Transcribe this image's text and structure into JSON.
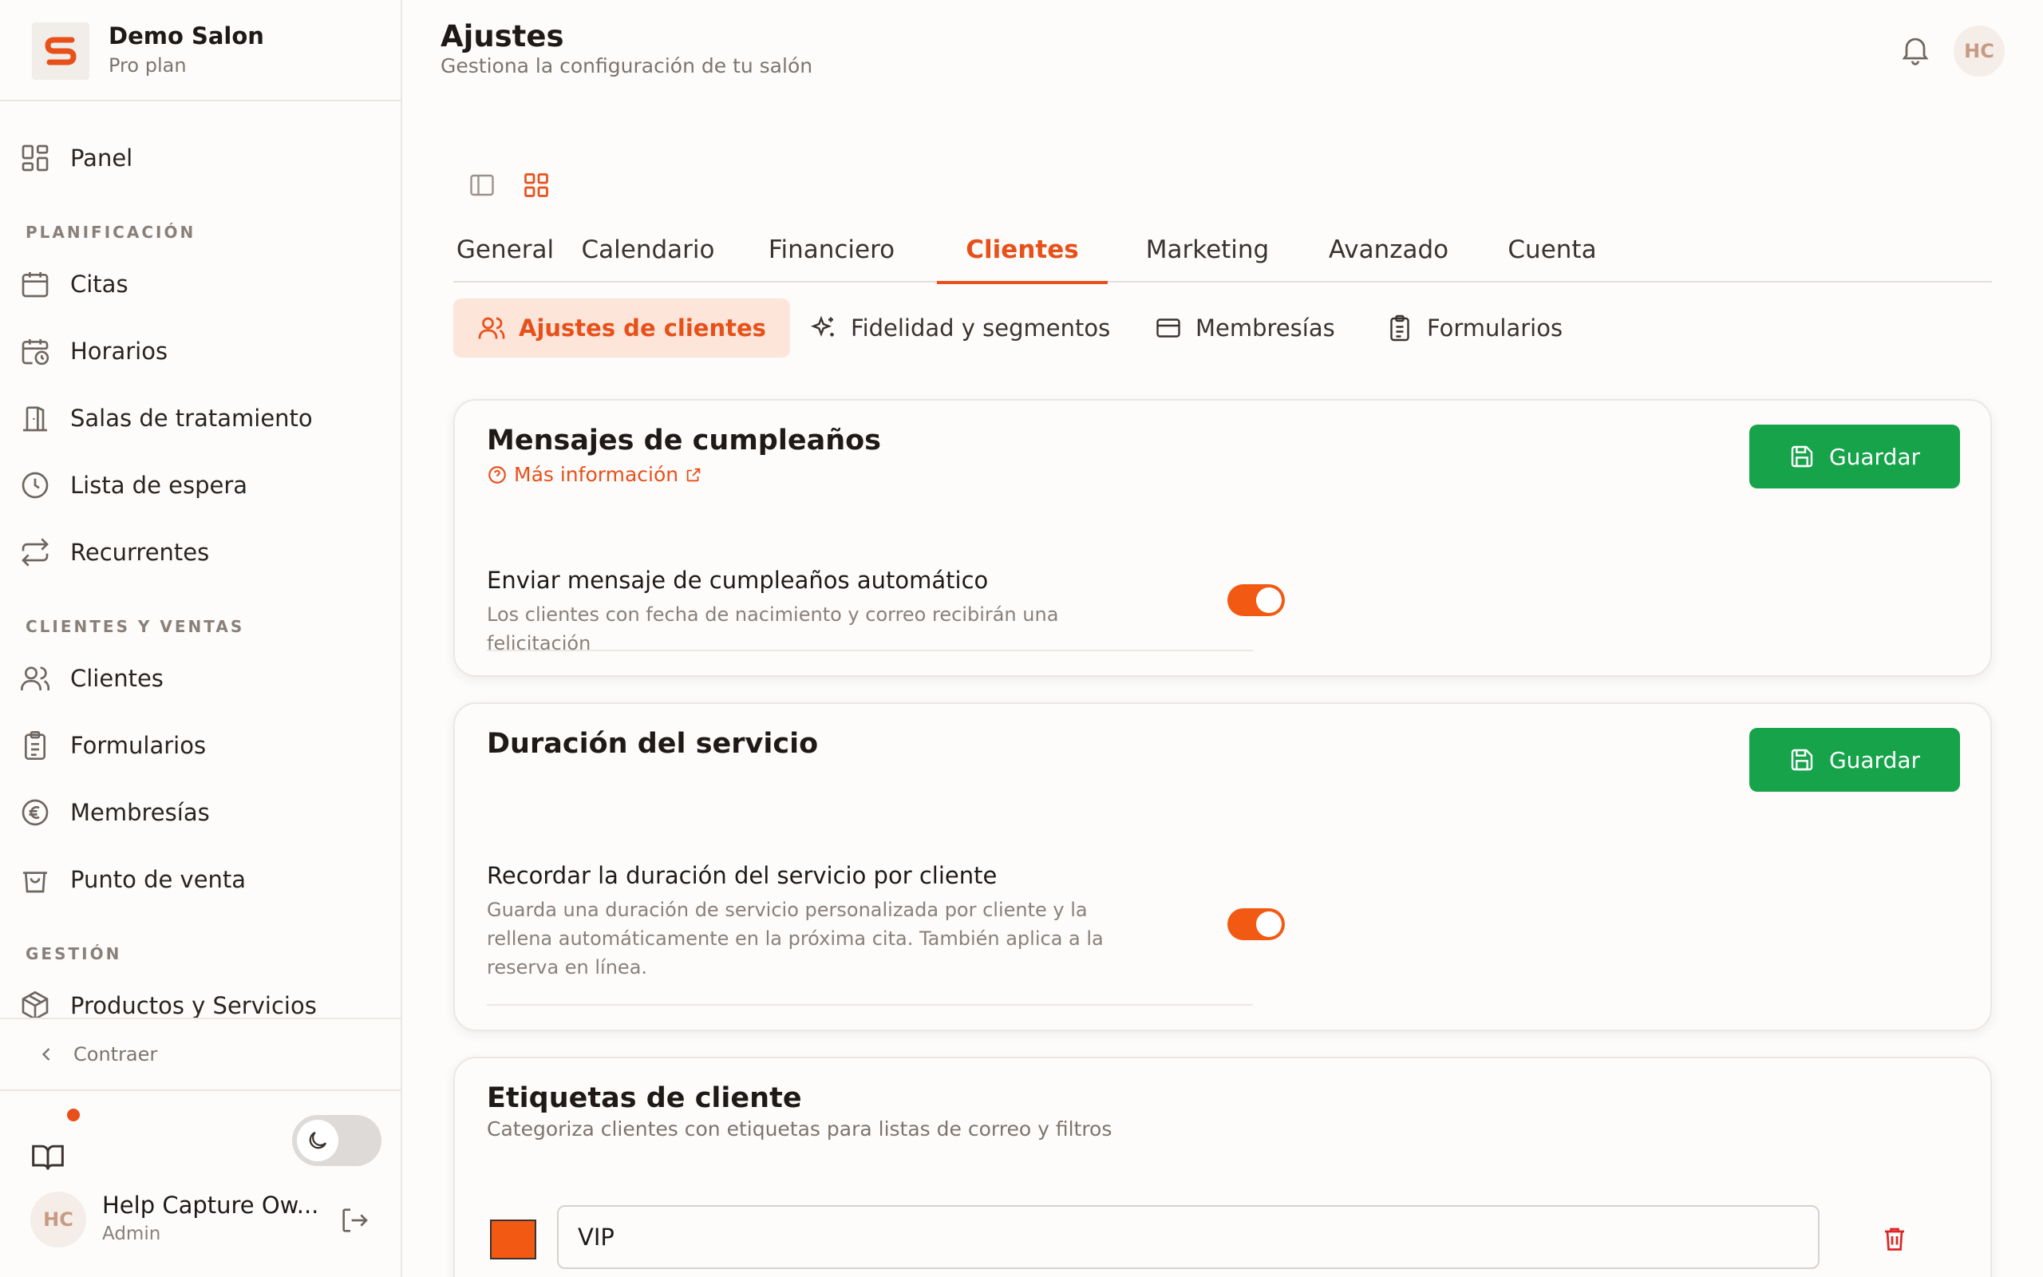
{
  "brand": {
    "logo_letter": "S",
    "name": "Demo Salon",
    "plan": "Pro plan"
  },
  "nav": {
    "dashboard": "Panel",
    "sections": {
      "planning": "PLANIFICACIÓN",
      "clients_sales": "CLIENTES Y VENTAS",
      "management": "GESTIÓN"
    },
    "planning_items": [
      "Citas",
      "Horarios",
      "Salas de tratamiento",
      "Lista de espera",
      "Recurrentes"
    ],
    "clients_items": [
      "Clientes",
      "Formularios",
      "Membresías",
      "Punto de venta"
    ],
    "management_items": [
      "Productos y Servicios"
    ],
    "collapse_label": "Contraer"
  },
  "user": {
    "initials": "HC",
    "name": "Help Capture Ow...",
    "role": "Admin"
  },
  "header": {
    "title": "Ajustes",
    "subtitle": "Gestiona la configuración de tu salón",
    "avatar_initials": "HC"
  },
  "tabs": [
    "General",
    "Calendario",
    "Financiero",
    "Clientes",
    "Marketing",
    "Avanzado",
    "Cuenta"
  ],
  "active_tab": "Clientes",
  "subtabs": [
    "Ajustes de clientes",
    "Fidelidad y segmentos",
    "Membresías",
    "Formularios"
  ],
  "active_subtab": "Ajustes de clientes",
  "cards": {
    "birthday": {
      "title": "Mensajes de cumpleaños",
      "more_info": "Más información",
      "save": "Guardar",
      "setting_label": "Enviar mensaje de cumpleaños automático",
      "setting_help": "Los clientes con fecha de nacimiento y correo recibirán una felicitación",
      "enabled": true
    },
    "duration": {
      "title": "Duración del servicio",
      "save": "Guardar",
      "setting_label": "Recordar la duración del servicio por cliente",
      "setting_help": "Guarda una duración de servicio personalizada por cliente y la rellena automáticamente en la próxima cita. También aplica a la reserva en línea.",
      "enabled": true
    },
    "tags": {
      "title": "Etiquetas de cliente",
      "description": "Categoriza clientes con etiquetas para listas de correo y filtros",
      "items": [
        {
          "name": "VIP",
          "color": "#f25a14"
        }
      ]
    }
  },
  "colors": {
    "accent": "#e8501a",
    "save_green": "#16a34a",
    "toggle_on": "#f25a14",
    "delete_red": "#dc2626"
  },
  "icons": {
    "theme": "moon-icon",
    "notifications": "bell-icon",
    "docs": "book-icon",
    "logout": "logout-icon"
  }
}
